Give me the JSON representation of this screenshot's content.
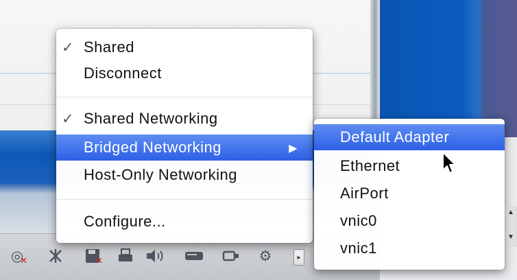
{
  "menu": {
    "items": [
      {
        "label": "Shared",
        "checked": true
      },
      {
        "label": "Disconnect",
        "checked": false
      },
      {
        "label": "Shared Networking",
        "checked": true
      },
      {
        "label": "Bridged Networking",
        "checked": false,
        "highlighted": true,
        "has_submenu": true
      },
      {
        "label": "Host-Only Networking",
        "checked": false
      },
      {
        "label": "Configure...",
        "checked": false
      }
    ],
    "check_glyph": "✓",
    "submenu_arrow_glyph": "▶"
  },
  "submenu": {
    "items": [
      {
        "label": "Default Adapter",
        "highlighted": true
      },
      {
        "label": "Ethernet"
      },
      {
        "label": "AirPort"
      },
      {
        "label": "vnic0"
      },
      {
        "label": "vnic1"
      }
    ]
  },
  "toolbar": {
    "icons": [
      {
        "name": "cd-disconnected-icon",
        "glyph": "◎"
      },
      {
        "name": "network-icon",
        "glyph": "✕"
      },
      {
        "name": "floppy-disconnected-icon",
        "glyph": "▣"
      },
      {
        "name": "printer-icon",
        "glyph": "⎙"
      },
      {
        "name": "sound-icon",
        "glyph": "🔈"
      },
      {
        "name": "hard-disk-icon",
        "glyph": "▭"
      },
      {
        "name": "usb-icon",
        "glyph": "⊟"
      },
      {
        "name": "settings-icon",
        "glyph": "⚙"
      }
    ],
    "more_glyph": "▸"
  },
  "colors": {
    "highlight": "#2d60e6",
    "window_blue": "#0c58b8",
    "menu_bg": "#ffffff"
  }
}
